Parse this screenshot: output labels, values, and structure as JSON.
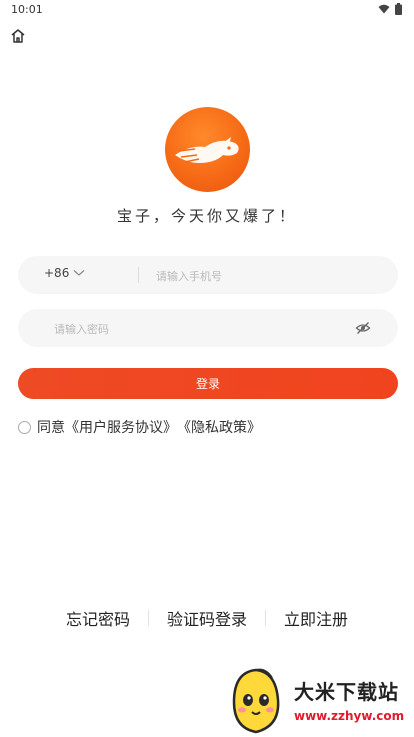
{
  "status_bar": {
    "time": "10:01"
  },
  "brand": {
    "slogan": "宝子，今天你又爆了！",
    "accent_color": "#f05024"
  },
  "form": {
    "country_code": "+86",
    "phone_placeholder": "请输入手机号",
    "password_placeholder": "请输入密码",
    "login_label": "登录"
  },
  "agreement": {
    "prefix": "同意",
    "user_agreement": "《用户服务协议》",
    "privacy_policy": "《隐私政策》"
  },
  "bottom_links": {
    "forgot_password": "忘记密码",
    "sms_login": "验证码登录",
    "register": "立即注册"
  },
  "watermark": {
    "title": "大米下载站",
    "url": "www.zzhyw.com"
  }
}
